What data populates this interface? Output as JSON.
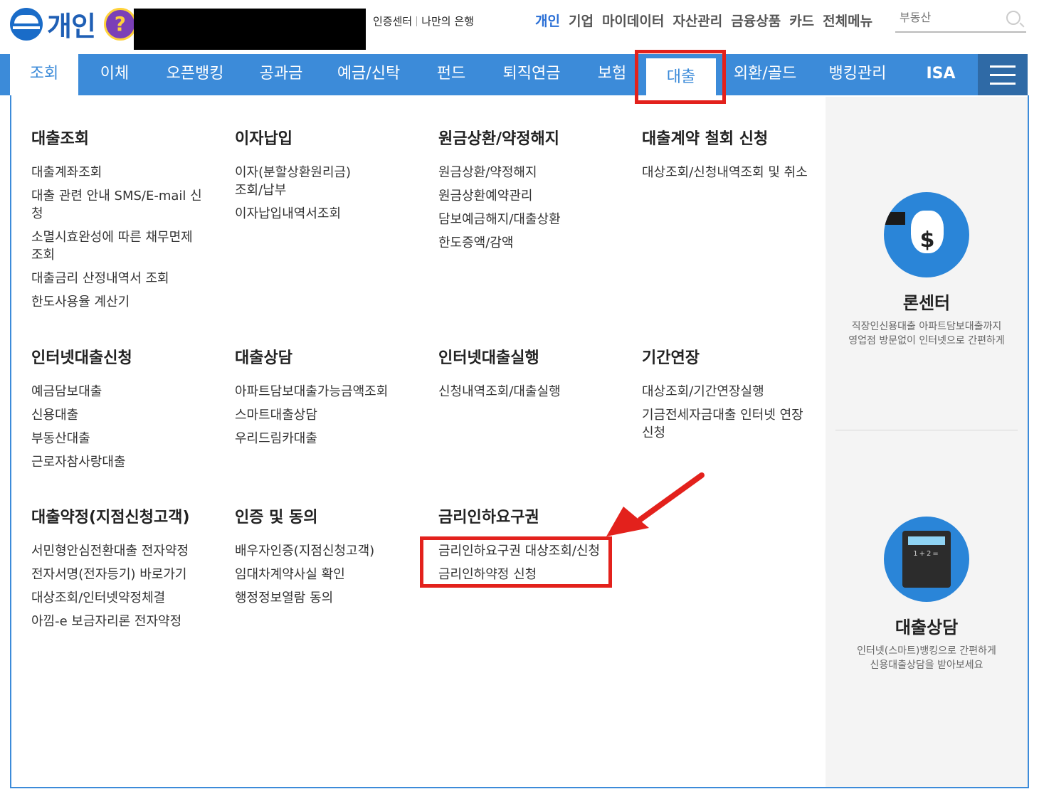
{
  "header": {
    "brand": "개인",
    "help_icon": "?",
    "util_links": [
      "인증센터",
      "나만의 은행"
    ],
    "top_nav": [
      {
        "label": "개인",
        "active": true
      },
      {
        "label": "기업",
        "active": false
      },
      {
        "label": "마이데이터",
        "active": false
      },
      {
        "label": "자산관리",
        "active": false
      },
      {
        "label": "금융상품",
        "active": false
      },
      {
        "label": "카드",
        "active": false
      },
      {
        "label": "전체메뉴",
        "active": false
      }
    ],
    "search_placeholder": "부동산"
  },
  "menubar": {
    "tabs": [
      "조회",
      "이체",
      "오픈뱅킹",
      "공과금",
      "예금/신탁",
      "펀드",
      "퇴직연금",
      "보험",
      "대출",
      "외환/골드",
      "뱅킹관리",
      "ISA"
    ],
    "active_tab": "조회",
    "highlighted_tab": "대출"
  },
  "dropdown": {
    "groups": [
      {
        "title": "대출조회",
        "items": [
          "대출계좌조회",
          "대출 관련 안내 SMS/E-mail 신청",
          "소멸시효완성에 따른 채무면제 조회",
          "대출금리 산정내역서 조회",
          "한도사용율 계산기"
        ]
      },
      {
        "title": "이자납입",
        "items": [
          "이자(분할상환원리금) 조회/납부",
          "이자납입내역서조회"
        ]
      },
      {
        "title": "원금상환/약정해지",
        "items": [
          "원금상환/약정해지",
          "원금상환예약관리",
          "담보예금해지/대출상환",
          "한도증액/감액"
        ]
      },
      {
        "title": "대출계약 철회 신청",
        "items": [
          "대상조회/신청내역조회 및 취소"
        ]
      },
      {
        "title": "인터넷대출신청",
        "items": [
          "예금담보대출",
          "신용대출",
          "부동산대출",
          "근로자참사랑대출"
        ]
      },
      {
        "title": "대출상담",
        "items": [
          "아파트담보대출가능금액조회",
          "스마트대출상담",
          "우리드림카대출"
        ]
      },
      {
        "title": "인터넷대출실행",
        "items": [
          "신청내역조회/대출실행"
        ]
      },
      {
        "title": "기간연장",
        "items": [
          "대상조회/기간연장실행",
          "기금전세자금대출 인터넷 연장신청"
        ]
      },
      {
        "title": "대출약정(지점신청고객)",
        "items": [
          "서민형안심전환대출 전자약정",
          "전자서명(전자등기) 바로가기",
          "대상조회/인터넷약정체결",
          "아낌-e 보금자리론 전자약정"
        ]
      },
      {
        "title": "인증 및 동의",
        "items": [
          "배우자인증(지점신청고객)",
          "임대차계약사실 확인",
          "행정정보열람 동의"
        ]
      },
      {
        "title": "금리인하요구권",
        "items": [
          "금리인하요구권 대상조회/신청",
          "금리인하약정 신청"
        ]
      }
    ]
  },
  "sidebar": {
    "promos": [
      {
        "title": "론센터",
        "desc": [
          "직장인신용대출 아파트담보대출까지",
          "영업점 방문없이 인터넷으로 간편하게"
        ],
        "icon": "money-bag-icon",
        "icon_text": "$"
      },
      {
        "title": "대출상담",
        "desc": [
          "인터넷(스마트)뱅킹으로 간편하게",
          "신용대출상담을 받아보세요"
        ],
        "icon": "calculator-icon",
        "icon_text": "1+2="
      }
    ]
  },
  "annotations": {
    "highlight_color": "#e3211c"
  },
  "colors": {
    "menubar": "#3c8bd9",
    "menu_button": "#2f6aa6",
    "brand": "#1f5fb5"
  }
}
